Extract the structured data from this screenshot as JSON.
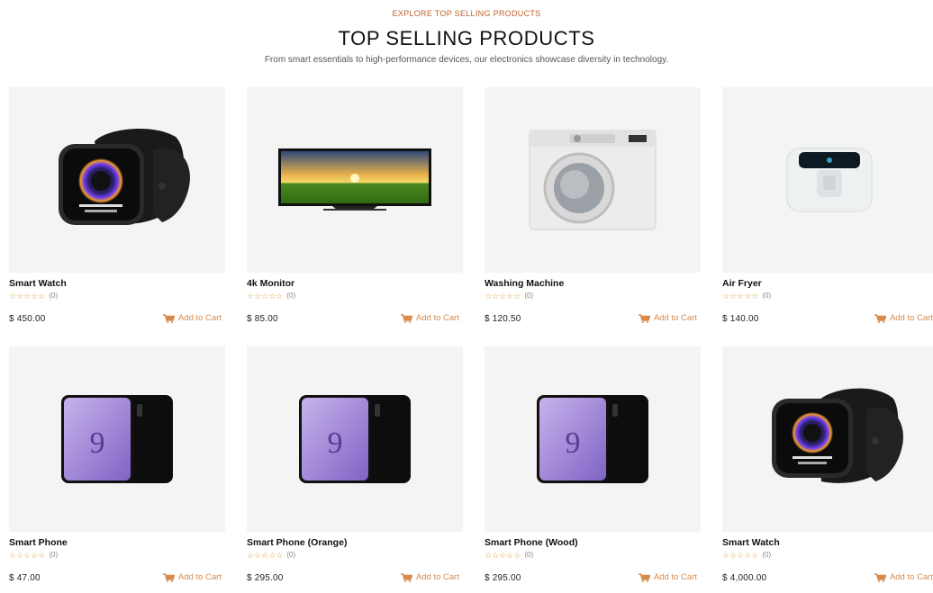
{
  "section": {
    "eyebrow": "EXPLORE TOP SELLING PRODUCTS",
    "title": "TOP SELLING PRODUCTS",
    "subtitle": "From smart essentials to high-performance devices, our electronics showcase diversity in technology."
  },
  "colors": {
    "accent": "#c2622b",
    "cart": "#d88a4b",
    "star": "#e0a23c",
    "card_bg": "#f4f4f4"
  },
  "products": [
    {
      "name": "Smart Watch",
      "stars": "☆☆☆☆☆",
      "count": "(0)",
      "price": "$ 450.00",
      "cart": "Add to Cart",
      "image": "smartwatch-image"
    },
    {
      "name": "4k Monitor",
      "stars": "☆☆☆☆☆",
      "count": "(0)",
      "price": "$ 85.00",
      "cart": "Add to Cart",
      "image": "monitor-image"
    },
    {
      "name": "Washing Machine",
      "stars": "☆☆☆☆☆",
      "count": "(0)",
      "price": "$ 120.50",
      "cart": "Add to Cart",
      "image": "washing-machine-image"
    },
    {
      "name": "Air Fryer",
      "stars": "☆☆☆☆☆",
      "count": "(0)",
      "price": "$ 140.00",
      "cart": "Add to Cart",
      "image": "air-fryer-image"
    },
    {
      "name": "Smart Phone",
      "stars": "☆☆☆☆☆",
      "count": "(0)",
      "price": "$ 47.00",
      "cart": "Add to Cart",
      "image": "smartphone-image"
    },
    {
      "name": "Smart Phone (Orange)",
      "stars": "☆☆☆☆☆",
      "count": "(0)",
      "price": "$ 295.00",
      "cart": "Add to Cart",
      "image": "smartphone-image"
    },
    {
      "name": "Smart Phone (Wood)",
      "stars": "☆☆☆☆☆",
      "count": "(0)",
      "price": "$ 295.00",
      "cart": "Add to Cart",
      "image": "smartphone-image"
    },
    {
      "name": "Smart Watch",
      "stars": "☆☆☆☆☆",
      "count": "(0)",
      "price": "$ 4,000.00",
      "cart": "Add to Cart",
      "image": "smartwatch-image"
    }
  ]
}
